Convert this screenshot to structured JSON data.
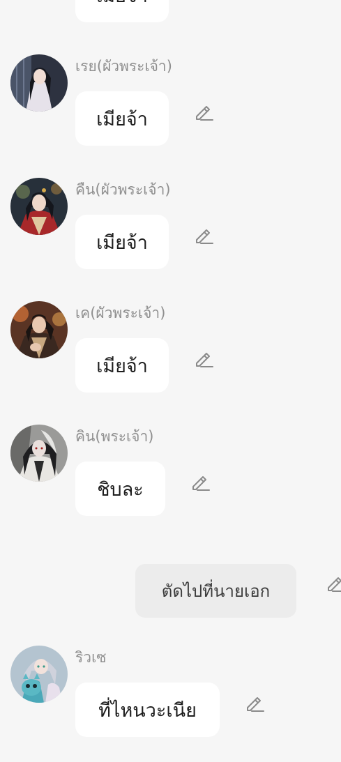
{
  "messages": [
    {
      "sender": "",
      "text": "เมียจ้า"
    },
    {
      "sender": "เรย(ผัวพระเจ้า)",
      "text": "เมียจ้า"
    },
    {
      "sender": "คืน(ผัวพระเจ้า)",
      "text": "เมียจ้า"
    },
    {
      "sender": "เค(ผัวพระเจ้า)",
      "text": "เมียจ้า"
    },
    {
      "sender": "คิน(พระเจ้า)",
      "text": "ชิบละ"
    },
    {
      "sender": "ริวเซ",
      "text": "ที่ไหนวะเนีย"
    }
  ],
  "narration": {
    "text": "ตัดไปที่นายเอก"
  },
  "icons": {
    "edit": "pencil-edit-icon"
  },
  "colors": {
    "background": "#f6f6f6",
    "bubble": "#ffffff",
    "narration_bubble": "#ececec",
    "sender_name": "#8f8f8f",
    "icon": "#8a8a8a"
  }
}
